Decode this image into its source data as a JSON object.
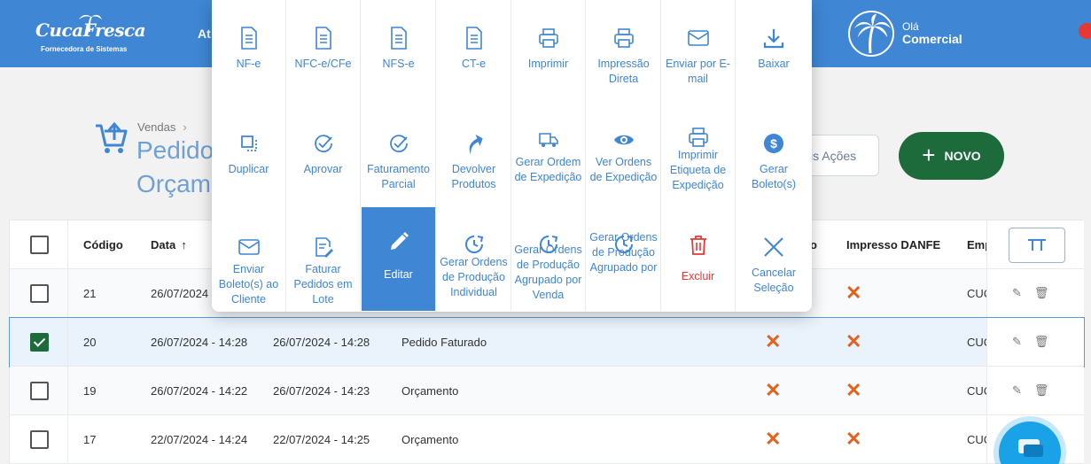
{
  "header": {
    "logo_text": "CucaFresca",
    "logo_sub": "Fornecedora de Sistemas",
    "nav_item": "At",
    "greeting": "Olá",
    "user_name": "Comercial"
  },
  "page": {
    "breadcrumb_root": "Vendas",
    "title_line1": "Pedido",
    "title_line2": "Orçam",
    "more_actions_label": "is Ações",
    "new_button_label": "NOVO"
  },
  "table": {
    "columns": {
      "codigo": "Código",
      "data": "Data",
      "impresso": "o",
      "impresso_danfe": "Impresso DANFE",
      "empresa": "Emp"
    },
    "rows": [
      {
        "codigo": "21",
        "data": "26/07/2024 - 14:",
        "alterado": "",
        "status": "",
        "checked": false,
        "selected": false,
        "empresa": "CUC"
      },
      {
        "codigo": "20",
        "data": "26/07/2024 - 14:28",
        "alterado": "26/07/2024 - 14:28",
        "status": "Pedido Faturado",
        "checked": true,
        "selected": true,
        "empresa": "CUC"
      },
      {
        "codigo": "19",
        "data": "26/07/2024 - 14:22",
        "alterado": "26/07/2024 - 14:23",
        "status": "Orçamento",
        "checked": false,
        "selected": false,
        "empresa": "CUC"
      },
      {
        "codigo": "17",
        "data": "22/07/2024 - 14:24",
        "alterado": "22/07/2024 - 14:25",
        "status": "Orçamento",
        "checked": false,
        "selected": false,
        "empresa": "CUC"
      }
    ]
  },
  "popup": {
    "tiles": [
      {
        "label": "NF-e",
        "icon": "document-icon"
      },
      {
        "label": "NFC-e/CFe",
        "icon": "document-icon"
      },
      {
        "label": "NFS-e",
        "icon": "document-icon"
      },
      {
        "label": "CT-e",
        "icon": "document-icon"
      },
      {
        "label": "Imprimir",
        "icon": "printer-icon"
      },
      {
        "label": "Impressão Direta",
        "icon": "printer-icon"
      },
      {
        "label": "Enviar por E-mail",
        "icon": "envelope-icon"
      },
      {
        "label": "Baixar",
        "icon": "download-icon"
      },
      {
        "label": "Duplicar",
        "icon": "duplicate-icon"
      },
      {
        "label": "Aprovar",
        "icon": "check-circle-icon"
      },
      {
        "label": "Faturamento Parcial",
        "icon": "check-circle-icon"
      },
      {
        "label": "Devolver Produtos",
        "icon": "return-arrow-icon"
      },
      {
        "label": "Gerar Ordem de Expedição",
        "icon": "truck-icon"
      },
      {
        "label": "Ver Ordens de Expedição",
        "icon": "eye-icon"
      },
      {
        "label": "Imprimir Etiqueta de Expedição",
        "icon": "printer-icon"
      },
      {
        "label": "Gerar Boleto(s)",
        "icon": "dollar-icon"
      },
      {
        "label": "Enviar Boleto(s) ao Cliente",
        "icon": "envelope-icon"
      },
      {
        "label": "Faturar Pedidos em Lote",
        "icon": "edit-document-icon"
      },
      {
        "label": "Editar",
        "icon": "pencil-icon"
      },
      {
        "label": "Gerar Ordens de Produção Individual",
        "icon": "clock-icon"
      },
      {
        "label": "Gerar Ordens de Produção Agrupado por Venda",
        "icon": "clock-icon"
      },
      {
        "label": "Gerar Ordens de Produção Agrupado por",
        "icon": "clock-icon"
      },
      {
        "label": "Excluir",
        "icon": "trash-icon"
      },
      {
        "label": "Cancelar Seleção",
        "icon": "close-icon"
      }
    ]
  },
  "colors": {
    "brand_blue": "#3f86d4",
    "new_button": "#1d6b3a",
    "danger": "#e53935",
    "x_mark": "#e2611b"
  }
}
